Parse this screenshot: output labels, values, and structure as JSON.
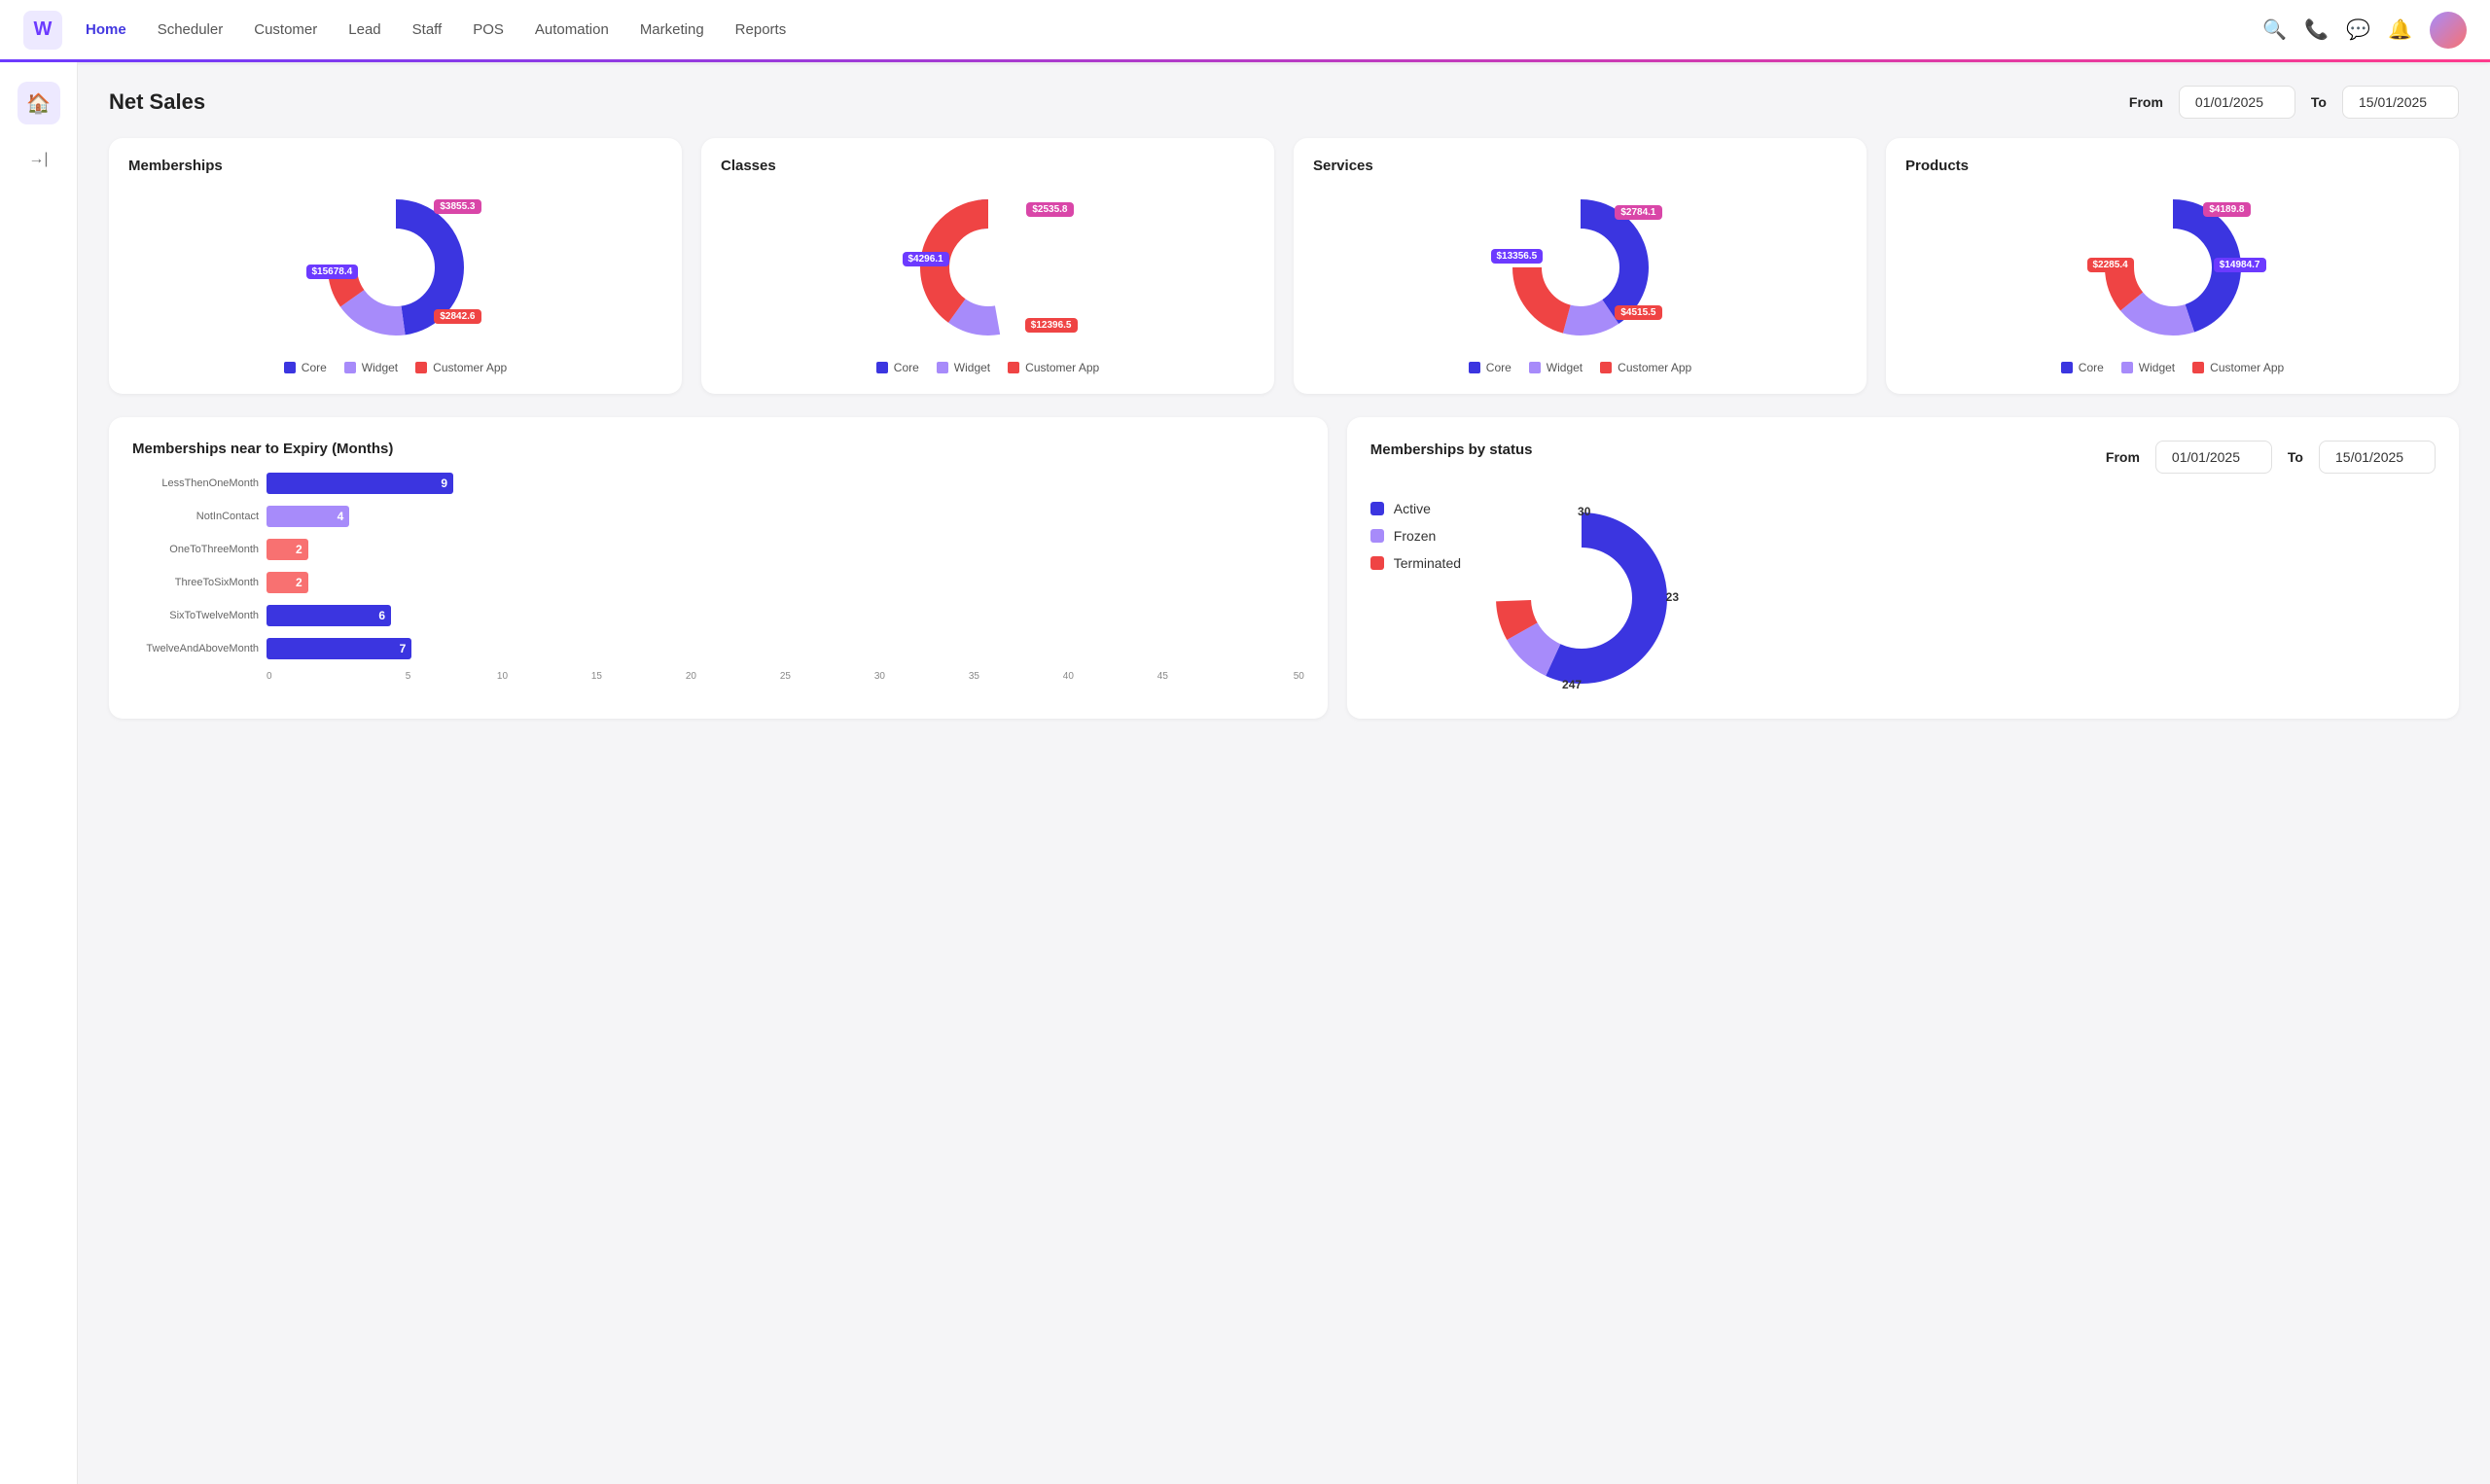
{
  "nav": {
    "logo": "W",
    "links": [
      {
        "label": "Home",
        "active": true
      },
      {
        "label": "Scheduler",
        "active": false
      },
      {
        "label": "Customer",
        "active": false
      },
      {
        "label": "Lead",
        "active": false
      },
      {
        "label": "Staff",
        "active": false
      },
      {
        "label": "POS",
        "active": false
      },
      {
        "label": "Automation",
        "active": false
      },
      {
        "label": "Marketing",
        "active": false
      },
      {
        "label": "Reports",
        "active": false
      }
    ]
  },
  "net_sales": {
    "title": "Net Sales",
    "from_label": "From",
    "from_date": "01/01/2025",
    "to_label": "To",
    "to_date": "15/01/2025"
  },
  "memberships": {
    "title": "Memberships",
    "core_val": "$15678.4",
    "widget_val": "$3855.3",
    "customer_val": "$2842.6",
    "core_color": "#3b35e0",
    "widget_color": "#a78bfa",
    "customer_color": "#ef4444",
    "legend": [
      "Core",
      "Widget",
      "Customer App"
    ]
  },
  "classes": {
    "title": "Classes",
    "core_val": "$4296.1",
    "widget_val": "$2535.8",
    "customer_val": "$12396.5",
    "core_color": "#3b35e0",
    "widget_color": "#a78bfa",
    "customer_color": "#ef4444",
    "legend": [
      "Core",
      "Widget",
      "Customer App"
    ]
  },
  "services": {
    "title": "Services",
    "core_val": "$13356.5",
    "widget_val": "$2784.1",
    "customer_val": "$4515.5",
    "core_color": "#3b35e0",
    "widget_color": "#a78bfa",
    "customer_color": "#ef4444",
    "legend": [
      "Core",
      "Widget",
      "Customer App"
    ]
  },
  "products": {
    "title": "Products",
    "core_val": "$14984.7",
    "widget_val": "$4189.8",
    "customer_val": "$2285.4",
    "core_color": "#3b35e0",
    "widget_color": "#a78bfa",
    "customer_color": "#ef4444",
    "legend": [
      "Core",
      "Widget",
      "Customer App"
    ]
  },
  "expiry_chart": {
    "title": "Memberships near to Expiry (Months)",
    "bars": [
      {
        "label": "LessThenOneMonth",
        "value": 9,
        "max": 50,
        "color": "#3b35e0"
      },
      {
        "label": "NotInContact",
        "value": 4,
        "max": 50,
        "color": "#a78bfa"
      },
      {
        "label": "OneToThreeMonth",
        "value": 2,
        "max": 50,
        "color": "#f87171"
      },
      {
        "label": "ThreeToSixMonth",
        "value": 2,
        "max": 50,
        "color": "#f87171"
      },
      {
        "label": "SixToTwelveMonth",
        "value": 6,
        "max": 50,
        "color": "#3b35e0"
      },
      {
        "label": "TwelveAndAboveMonth",
        "value": 7,
        "max": 50,
        "color": "#3b35e0"
      }
    ],
    "x_ticks": [
      "0",
      "5",
      "10",
      "15",
      "20",
      "25",
      "30",
      "35",
      "40",
      "45",
      "50"
    ]
  },
  "status_chart": {
    "title": "Memberships by status",
    "from_label": "From",
    "from_date": "01/01/2025",
    "to_label": "To",
    "to_date": "15/01/2025",
    "legend": [
      {
        "label": "Active",
        "color": "#3b35e0"
      },
      {
        "label": "Frozen",
        "color": "#a78bfa"
      },
      {
        "label": "Terminated",
        "color": "#ef4444"
      }
    ],
    "active_val": 247,
    "frozen_val": 30,
    "terminated_val": 23
  }
}
